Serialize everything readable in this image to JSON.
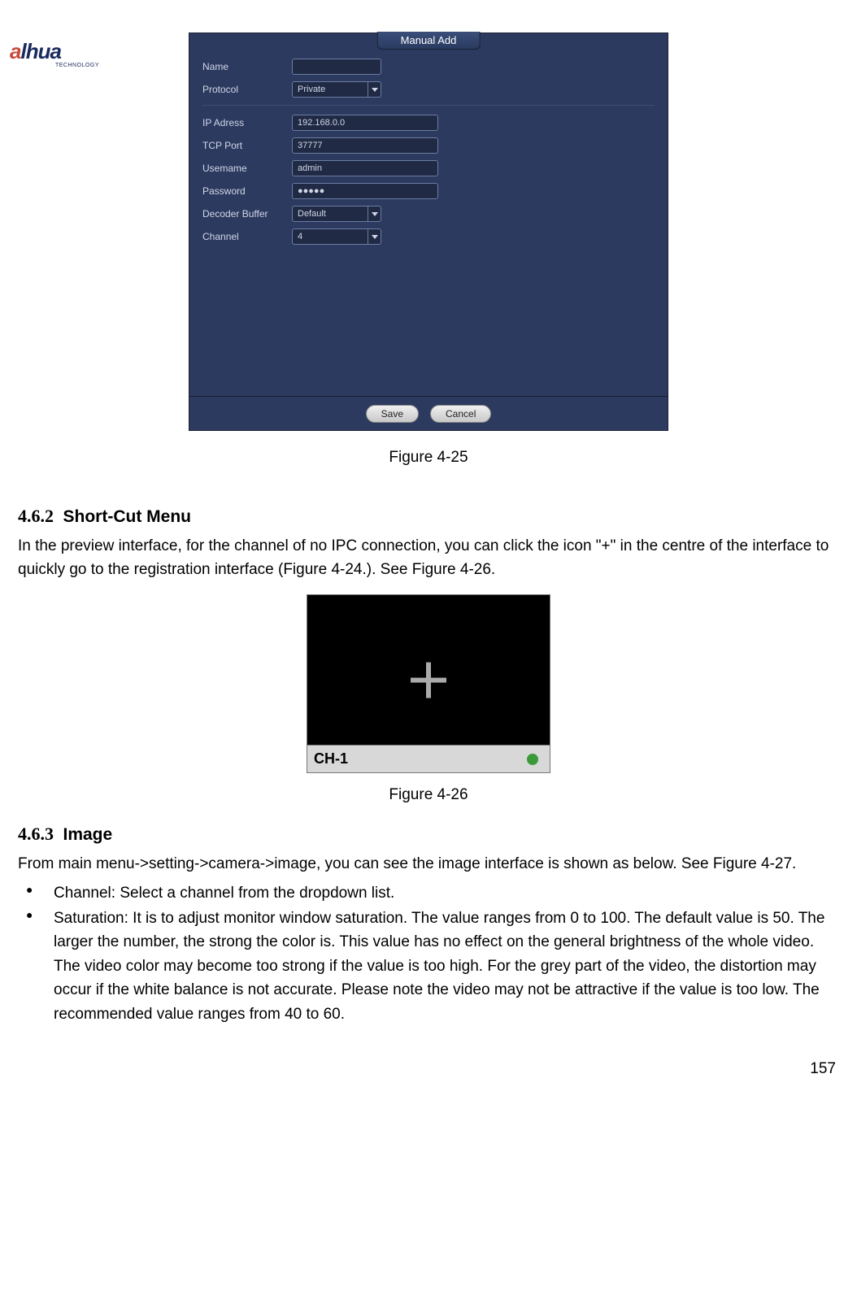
{
  "logo": {
    "a": "a",
    "rest": "lhua",
    "sub": "TECHNOLOGY"
  },
  "dlg25": {
    "tab": "Manual Add",
    "fields": {
      "name_lbl": "Name",
      "name_val": "",
      "protocol_lbl": "Protocol",
      "protocol_val": "Private",
      "ip_lbl": "IP Adress",
      "ip_val": "192.168.0.0",
      "tcp_lbl": "TCP Port",
      "tcp_val": "37777",
      "user_lbl": "Usemame",
      "user_val": "admin",
      "pass_lbl": "Password",
      "pass_val": "●●●●●",
      "buf_lbl": "Decoder Buffer",
      "buf_val": "Default",
      "chan_lbl": "Channel",
      "chan_val": "4"
    },
    "save": "Save",
    "cancel": "Cancel"
  },
  "cap25": "Figure 4-25",
  "sec462_num": "4.6.2",
  "sec462_ttl": "Short-Cut Menu",
  "para462": "In the preview interface, for the channel of no IPC connection, you can click the icon \"+\" in the centre of the interface to quickly go to the registration interface (Figure 4-24.). See Figure 4-26.",
  "preview": {
    "ch": "CH-1"
  },
  "cap26": "Figure 4-26",
  "sec463_num": "4.6.3",
  "sec463_ttl": "Image",
  "para463": "From main menu->setting->camera->image, you can see the image interface is shown as below. See Figure 4-27.",
  "bullets": [
    "Channel: Select a channel from the dropdown list.",
    "Saturation: It is to adjust monitor window saturation. The value ranges from 0 to 100. The default value is 50. The larger the number, the strong the color is. This value has no effect on the general brightness of the whole video. The video color may become too strong if the value is too high. For the grey part of the video, the distortion may occur if the white balance is not accurate.    Please note the video may not be attractive if the value is too low. The recommended value ranges from 40 to 60."
  ],
  "pagenum": "157"
}
